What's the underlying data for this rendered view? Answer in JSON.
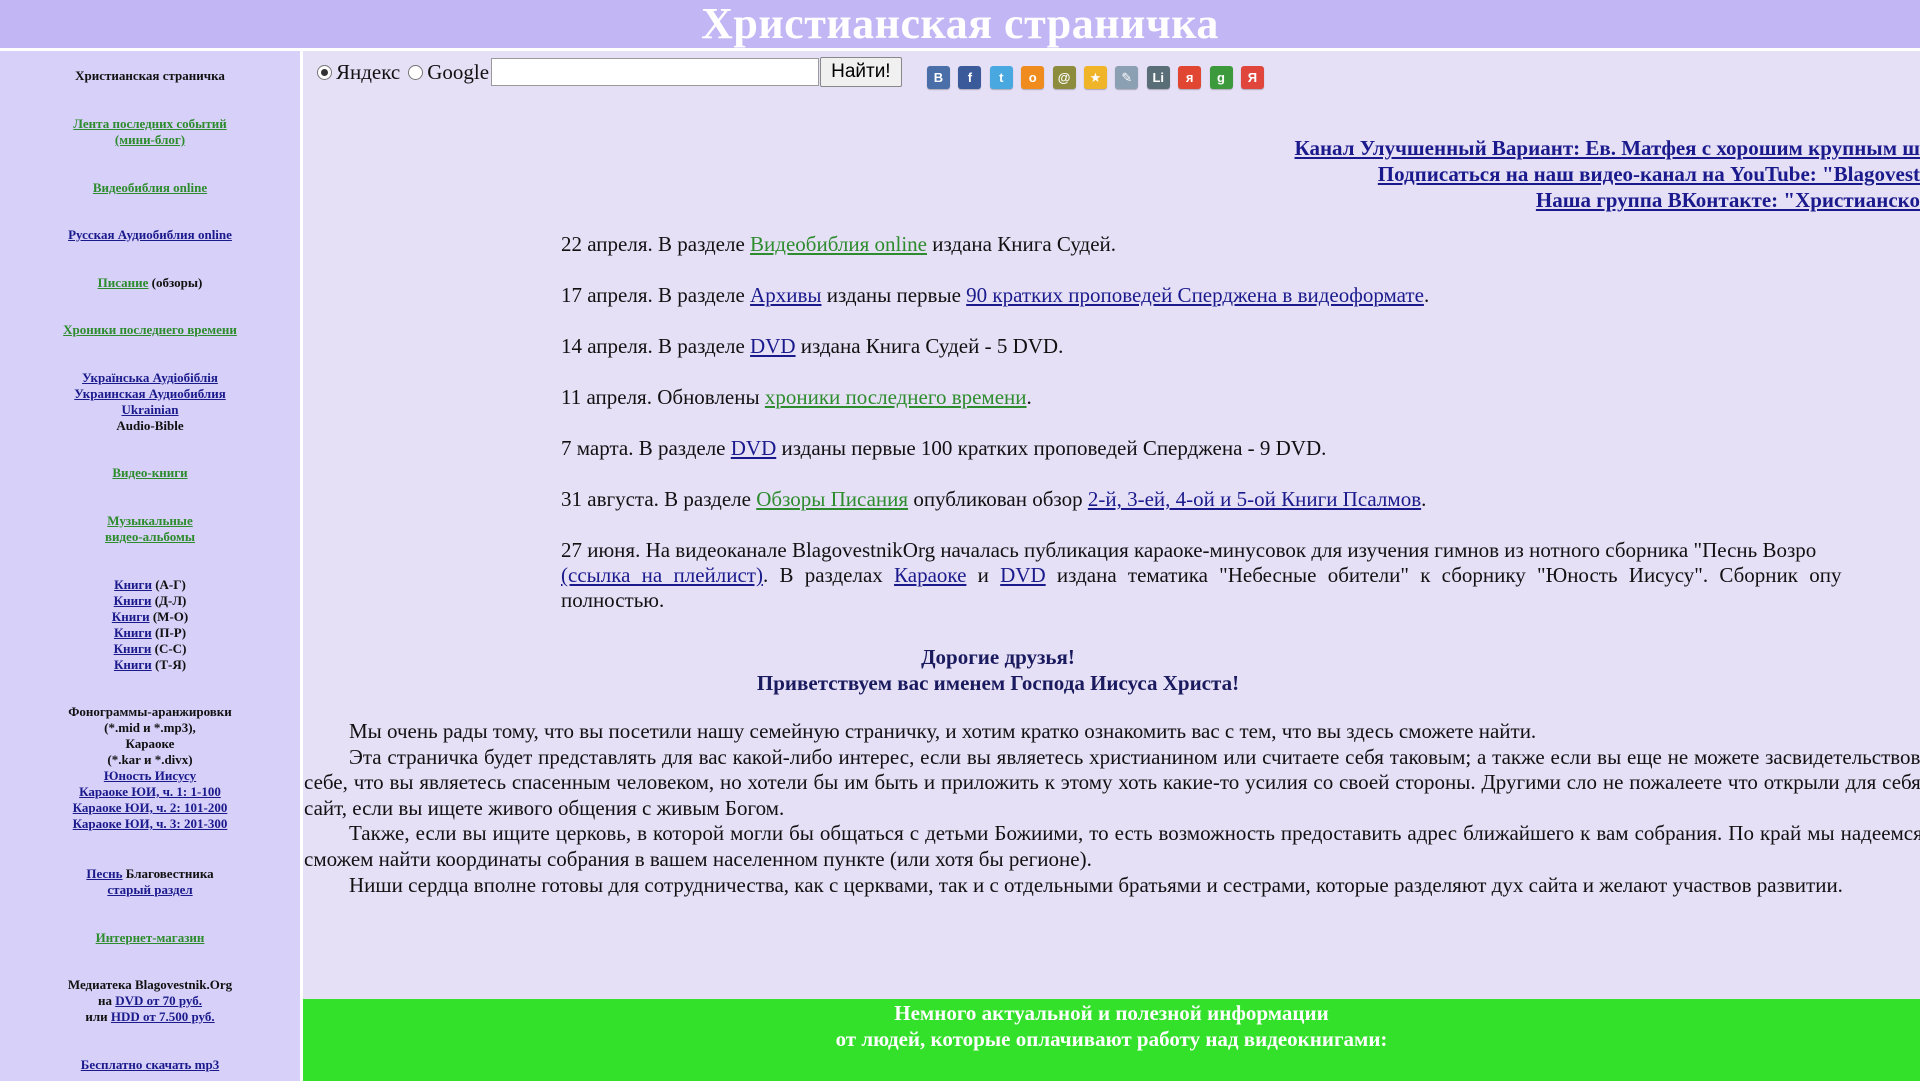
{
  "header": {
    "title": "Христианская страничка"
  },
  "sidebar": {
    "site_title": "Христианская страничка",
    "feed": "Лента последних событий (мини-блог)",
    "videobible": "Видеобиблия online",
    "audiobible": "Русская Аудиобиблия online",
    "scripture_link": "Писание",
    "scripture_suffix": " (обзоры)",
    "chronicles": "Хроники последнего времени",
    "ukr1": "Українська Аудіобіблія",
    "ukr2": "Украинская Аудиобиблия",
    "ukr3": "Ukrainian",
    "ukr4": "Audio-Bible",
    "videobooks": "Видео-книги",
    "music1": "Музыкальные",
    "music2": "видео-альбомы",
    "books": [
      {
        "link": "Книги",
        "range": " (А-Г)"
      },
      {
        "link": "Книги",
        "range": " (Д-Л)"
      },
      {
        "link": "Книги",
        "range": " (М-О)"
      },
      {
        "link": "Книги",
        "range": " (П-Р)"
      },
      {
        "link": "Книги",
        "range": " (С-С)"
      },
      {
        "link": "Книги",
        "range": " (Т-Я)"
      }
    ],
    "phono1": "Фонограммы-аранжировки",
    "phono2": "(*.mid и *.mp3),",
    "phono3": "Караоке",
    "phono4": "(*.kar и *.divx)",
    "youth": "Юность Иисусу",
    "karaoke1": "Караоке ЮИ, ч. 1: 1-100",
    "karaoke2": "Караоке ЮИ, ч. 2: 101-200",
    "karaoke3": "Караоке ЮИ, ч. 3: 201-300",
    "song_link": "Песнь",
    "song_suffix": " Благовестника",
    "old_section": "старый раздел",
    "shops": "Интернет-магазин",
    "media1": "Медиатека Blagovestnik.Org",
    "media2_pre": "на ",
    "media2_link": "DVD от 70 руб.",
    "media3_pre": "или ",
    "media3_link": "HDD от 7.500 руб.",
    "free_mp3": "Бесплатно скачать mp3"
  },
  "search": {
    "option_yandex": "Яндекс",
    "option_google": "Google",
    "value": "",
    "button": "Найти!"
  },
  "social": [
    {
      "name": "vk-icon",
      "glyph": "B",
      "color": "#4a6ea8"
    },
    {
      "name": "facebook-icon",
      "glyph": "f",
      "color": "#3b5a9a"
    },
    {
      "name": "twitter-icon",
      "glyph": "t",
      "color": "#4aa8e0"
    },
    {
      "name": "odnoklassniki-icon",
      "glyph": "o",
      "color": "#f08c1e"
    },
    {
      "name": "mailru-icon",
      "glyph": "@",
      "color": "#8c8c3c"
    },
    {
      "name": "bookmark-star-icon",
      "glyph": "★",
      "color": "#f0b428"
    },
    {
      "name": "livejournal-icon",
      "glyph": "✎",
      "color": "#8ca0b4"
    },
    {
      "name": "liveinternet-icon",
      "glyph": "Li",
      "color": "#5a6e78"
    },
    {
      "name": "moikrug-icon",
      "glyph": "я",
      "color": "#e04632"
    },
    {
      "name": "google-icon",
      "glyph": "g",
      "color": "#3c9a3c"
    },
    {
      "name": "yandex-icon",
      "glyph": "Я",
      "color": "#e0463c"
    }
  ],
  "top_links": {
    "line1": "Канал Улучшенный Вариант: Ев. Матфея с хорошим крупным ш",
    "line2": "Подписаться на наш видео-канал на YouTube: \"Blagovest",
    "line3": "Наша группа ВКонтакте: \"Христианско"
  },
  "news": {
    "n1": {
      "pre": "22 апреля. В разделе ",
      "link": "Видеобиблия online",
      "post": " издана Книга Судей."
    },
    "n2": {
      "pre": "17 апреля. В разделе ",
      "link": "Архивы",
      "mid": " изданы первые ",
      "link2": "90 кратких проповедей Сперджена в видеоформате",
      "post": "."
    },
    "n3": {
      "pre": "14 апреля. В разделе ",
      "link": "DVD",
      "post": " издана Книга Судей - 5 DVD."
    },
    "n4": {
      "pre": "11 апреля. Обновлены ",
      "link": "хроники последнего времени",
      "post": "."
    },
    "n5": {
      "pre": "7 марта. В разделе ",
      "link": "DVD",
      "post": " изданы первые 100 кратких проповедей Сперджена - 9 DVD."
    },
    "n6": {
      "pre": "31 августа. В разделе ",
      "link": "Обзоры Писания",
      "mid": " опубликован обзор ",
      "link2": "2-й, 3-ей, 4-ой и 5-ой Книги Псалмов",
      "post": "."
    },
    "n7": {
      "line1": "27 июня. На видеоканале BlagovestnikOrg началась публикация караоке-минусовок для изучения гимнов из нотного сборника \"Песнь Возро",
      "link_playlist": "(ссылка на плейлист)",
      "t2": ". В разделах ",
      "link_karaoke": "Караоке",
      "t3": " и ",
      "link_dvd": "DVD",
      "t4": " издана тематика \"Небесные обители\" к сборнику \"Юность Иисусу\". Сборник опу",
      "line3": "полностью."
    }
  },
  "greeting": {
    "line1": "Дорогие друзья!",
    "line2": "Приветствуем вас именем Господа Иисуса Христа!"
  },
  "intro": {
    "p1": "Мы очень рады тому, что вы посетили нашу семейную страничку, и хотим кратко ознакомить вас с тем, что вы здесь сможете найти.",
    "p2": "Эта страничка будет представлять для вас какой-либо интерес, если вы являетесь христианином или считаете себя таковым; а также если вы еще не можете засвидетельствовать о себе, что вы являетесь спасенным человеком, но хотели бы им быть и приложить к этому хоть какие-то усилия со своей стороны. Другими сло не пожалеете что открыли для себя этот сайт, если вы ищете живого общения с живым Богом.",
    "p3": "Также, если вы ищите церковь, в которой могли бы общаться с детьми Божиими, то есть возможность предоставить адрес ближайшего к вам собрания. По край мы надеемся, что сможем найти координаты собрания в вашем населенном пункте (или хотя бы регионе).",
    "p4": "Ниши сердца вполне готовы для сотрудничества, как с церквами, так и с отдельными братьями и сестрами, которые разделяют дух сайта и желают участвов развитии."
  },
  "banner": {
    "line1": "Немного актуальной и полезной информации",
    "line2": "от людей, которые оплачивают работу над видеокнигами:"
  }
}
